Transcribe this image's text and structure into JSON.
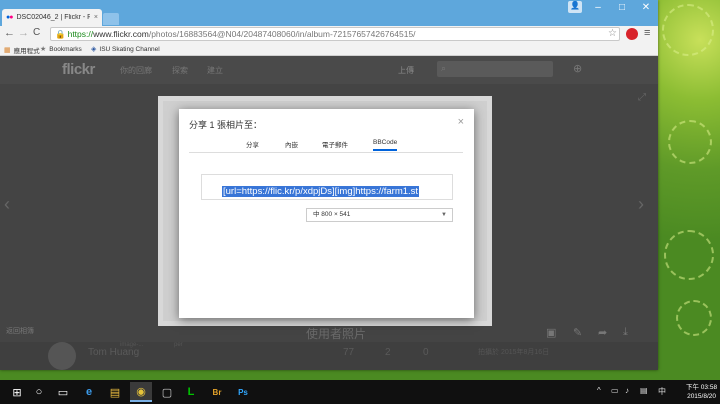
{
  "browser": {
    "tab_title": "DSC02046_2 | Flickr - Ph",
    "tab_close": "×",
    "window_buttons": {
      "minimize": "–",
      "maximize": "□",
      "close": "✕"
    },
    "nav": {
      "back": "←",
      "forward": "→",
      "reload": "C"
    },
    "url": {
      "https": "https://",
      "host": "www.flickr.com",
      "path": "/photos/16883564@N04/20487408060/in/album-72157657426764515/"
    },
    "menu_icon": "≡",
    "star_icon": "☆",
    "bookmarks": [
      {
        "icon": "▦",
        "label": "應用程式"
      },
      {
        "icon": "★",
        "label": "Bookmarks"
      },
      {
        "icon": "◈",
        "label": "ISU Skating Channel"
      }
    ]
  },
  "flickr": {
    "logo": "flickr",
    "nav": [
      "你的回廊",
      "探索",
      "建立"
    ],
    "upload": "上傳",
    "count_icon": "⊕",
    "search_icon": "⌕",
    "arrow_left": "‹",
    "arrow_right": "›",
    "expand_icon": "⤢",
    "back_link": "返回相簿",
    "photo_caption": "使用者照片",
    "owner_name": "Tom Huang",
    "owner_sub": "image-...",
    "owner_sub2": "per",
    "stats": [
      "77",
      "2",
      "0"
    ],
    "taken": "拍攝於 2015年8月16日",
    "actions": [
      "▣",
      "✎",
      "➦",
      "⤓"
    ]
  },
  "share_dialog": {
    "title": "分享 1 張相片至：",
    "close": "×",
    "tabs": [
      "分享",
      "內嵌",
      "電子郵件",
      "BBCode"
    ],
    "active_tab": "BBCode",
    "code": "[url=https://flic.kr/p/xdpjDs][img]https://farm1.st",
    "size_option": "中 800 × 541",
    "caret": "▼"
  },
  "taskbar": {
    "start_icon": "⊞",
    "search_icon": "○",
    "taskview_icon": "▭",
    "apps": [
      "e",
      "▤",
      "◉",
      "▢",
      "L",
      "Br",
      "Ps"
    ],
    "tray": [
      "^",
      "▭",
      "♪",
      "▤",
      "中"
    ],
    "time": "下午 03:58",
    "date": "2015/8/20"
  },
  "colors": {
    "titlebar": "#5ea7dc",
    "selection": "#3875d7",
    "flickr_blue": "#0063dc",
    "flickr_pink": "#ff0084",
    "desktop_green": "#6aa32c"
  }
}
